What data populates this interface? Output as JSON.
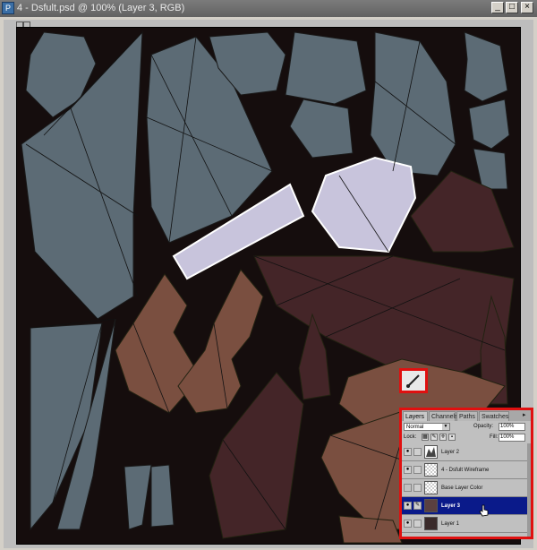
{
  "window": {
    "title": "4 - Dsfult.psd @ 100% (Layer 3, RGB)",
    "buttons": {
      "minimize": "_",
      "maximize": "□",
      "close": "×"
    }
  },
  "tool": {
    "icon": "brush-icon"
  },
  "layers_panel": {
    "tabs": [
      "Layers",
      "Channels",
      "Paths",
      "Swatches"
    ],
    "blend_mode": "Normal",
    "opacity_label": "Opacity:",
    "opacity_value": "100%",
    "lock_label": "Lock:",
    "fill_label": "Fill:",
    "fill_value": "100%",
    "layers": [
      {
        "name": "Layer 2",
        "visible": true,
        "selected": false
      },
      {
        "name": "4 - Dsfult Wireframe",
        "visible": true,
        "selected": false
      },
      {
        "name": "Base Layer Color",
        "visible": false,
        "selected": false
      },
      {
        "name": "Layer 3",
        "visible": true,
        "selected": true
      },
      {
        "name": "Layer 1",
        "visible": true,
        "selected": false
      }
    ]
  },
  "colors": {
    "canvas_bg": "#150d0d",
    "gray_shell": "#5c6b75",
    "light_lilac": "#c8c4dc",
    "brown_shell": "#7a4f40",
    "dark_maroon": "#442528",
    "highlight_red": "#e01010",
    "selected_layer": "#0a1a8a"
  }
}
